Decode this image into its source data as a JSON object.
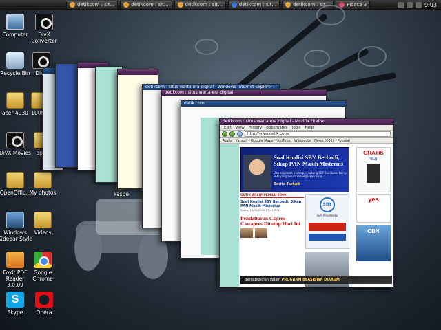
{
  "taskbar": {
    "buttons": [
      {
        "label": "detikcom : sit...",
        "color": "#e8a23a"
      },
      {
        "label": "detikcom : sit...",
        "color": "#e8a23a"
      },
      {
        "label": "detikcom : sit...",
        "color": "#e8a23a"
      },
      {
        "label": "detikcom : sit...",
        "color": "#3b7ad9"
      },
      {
        "label": "detikcom : sit...",
        "color": "#e8a23a"
      },
      {
        "label": "Picasa 3",
        "color": "#d84a6a"
      }
    ],
    "clock": "9:03"
  },
  "desktop_icons": [
    {
      "label": "Computer",
      "icon": "computer-icon"
    },
    {
      "label": "DivX Converter",
      "icon": "divx-converter-icon"
    },
    {
      "label": "Recycle Bin",
      "icon": "recycle-bin-icon"
    },
    {
      "label": "DivX",
      "icon": "divx-icon"
    },
    {
      "label": "acer 4930",
      "icon": "folder-icon"
    },
    {
      "label": "100MS",
      "icon": "folder-icon"
    },
    {
      "label": "DivX Movies",
      "icon": "divx-movies-icon"
    },
    {
      "label": "apup",
      "icon": "folder-icon"
    },
    {
      "label": "OpenOffic...",
      "icon": "folder-icon"
    },
    {
      "label": "My photos",
      "icon": "folder-icon"
    },
    {
      "label": "kaspe",
      "icon": "folder-icon"
    },
    {
      "label": "Windows Sidebar Style",
      "icon": "sidebar-icon"
    },
    {
      "label": "Videos",
      "icon": "folder-icon"
    },
    {
      "label": "Foxit PDF Reader 3.0.09",
      "icon": "foxit-icon"
    },
    {
      "label": "Google Chrome",
      "icon": "chrome-icon"
    },
    {
      "label": "Skype",
      "icon": "skype-icon"
    },
    {
      "label": "Opera",
      "icon": "opera-icon"
    }
  ],
  "stack_windows": [
    {
      "title": "detikcom : situs warta era digital - Windows Internet Explorer"
    },
    {
      "title": "detikcom : situs warta era digital"
    },
    {
      "title": "detik.com"
    }
  ],
  "front_window": {
    "title": "detikcom : situs warta era digital - Mozilla Firefox",
    "menu": [
      "Edit",
      "View",
      "History",
      "Bookmarks",
      "Tools",
      "Help"
    ],
    "url": "http://www.detik.com/",
    "bookmarks": [
      "Apple",
      "Yahoo!",
      "Google Maps",
      "YouTube",
      "Wikipedia",
      "News (601)",
      "Popular"
    ],
    "page": {
      "headline": "Soal Koalisi SBY Berbudi, Sikap PAN Masih Misterius",
      "headline_sub": "Dan sejumlah partai pendukung SBY-Boediono, hanya PAN yang belum menegaskan sikap.",
      "headline_tag": "Berita Terkait",
      "section_head": "DETIK ARSIP PEMILU 2009",
      "item_title": "Soal Koalisi SBY Berbudi, Sikap PAN Masih Misterius",
      "item_body": "Sabtu, 16/05/2009 17:41 WIB",
      "pendaftaran": "Pendaftaran Capres-Cawapres Ditutup Hari Ini",
      "sby_caption": "SBY Presidenku",
      "gratis": "GRATIS",
      "gratis_sub": "PELNI",
      "yes_label": "yes",
      "cbn_label": "CBN",
      "bottom_ad_text": "Bergabunglah dalam",
      "bottom_ad_highlight": "PROGRAM BEASISWA DJARUM"
    }
  }
}
